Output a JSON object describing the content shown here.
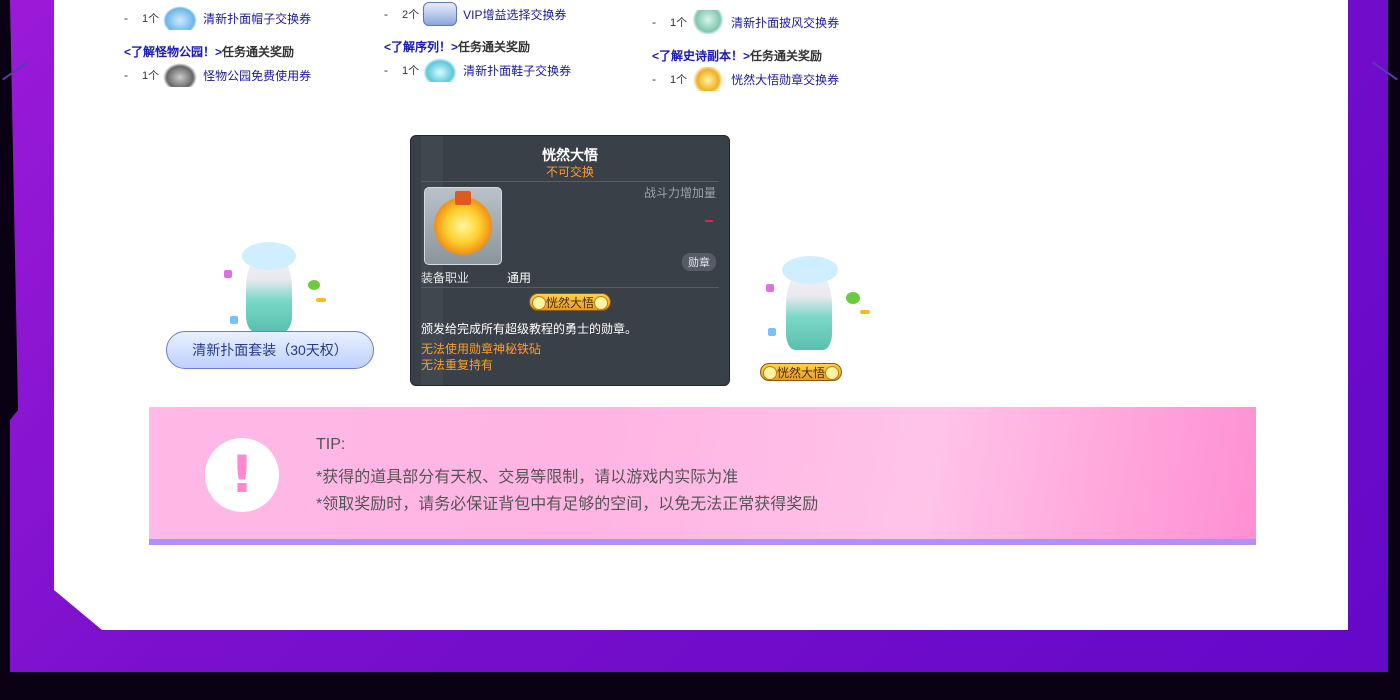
{
  "rewards": {
    "col1": {
      "item1": {
        "dash": "-",
        "qty": "1个",
        "icon": "hat-icon",
        "label": "清新扑面帽子交换券"
      },
      "quest": {
        "link": "<了解怪物公园！>",
        "rest": "任务通关奖励"
      },
      "item2": {
        "dash": "-",
        "qty": "1个",
        "icon": "car-icon",
        "label": "怪物公园免费使用券"
      }
    },
    "col2": {
      "item1": {
        "dash": "-",
        "qty": "2个",
        "icon": "vip-icon",
        "label": "VIP增益选择交换券"
      },
      "quest": {
        "link": "<了解序列！>",
        "rest": "任务通关奖励"
      },
      "item2": {
        "dash": "-",
        "qty": "1个",
        "icon": "shoe-icon",
        "label": "清新扑面鞋子交换券"
      }
    },
    "col3": {
      "item1": {
        "dash": "-",
        "qty": "1个",
        "icon": "cape-icon",
        "label": "清新扑面披风交换券"
      },
      "quest": {
        "link": "<了解史诗副本！>",
        "rest": "任务通关奖励"
      },
      "item2": {
        "dash": "-",
        "qty": "1个",
        "icon": "medal-icon",
        "label": "恍然大悟勋章交换券"
      }
    }
  },
  "tooltip": {
    "title": "恍然大悟",
    "subtitle": "不可交换",
    "power_label": "战斗力增加量",
    "power_value": "-",
    "category_badge": "勋章",
    "job_label": "装备职业",
    "job_value": "通用",
    "medal_name": "恍然大悟",
    "description": "颁发给完成所有超级教程的勇士的勋章。",
    "warning1": "无法使用勋章神秘铁砧",
    "warning2": "无法重复持有"
  },
  "outfit_button": {
    "label": "清新扑面套装（30天权）"
  },
  "medal_chip_right": {
    "label": "恍然大悟"
  },
  "tip": {
    "title": "TIP:",
    "line1": "*获得的道具部分有天权、交易等限制，请以游戏内实际为准",
    "line2": "*领取奖励时，请务必保证背包中有足够的空间，以免无法正常获得奖励",
    "icon": "exclamation-icon"
  },
  "colors": {
    "frame": "#7a10cc",
    "link_blue": "#1a1a9e",
    "tooltip_bg": "#3a4048",
    "tooltip_orange": "#ff9d2b",
    "tip_pink": "#ffb9e6",
    "tip_border": "#b090ff"
  }
}
